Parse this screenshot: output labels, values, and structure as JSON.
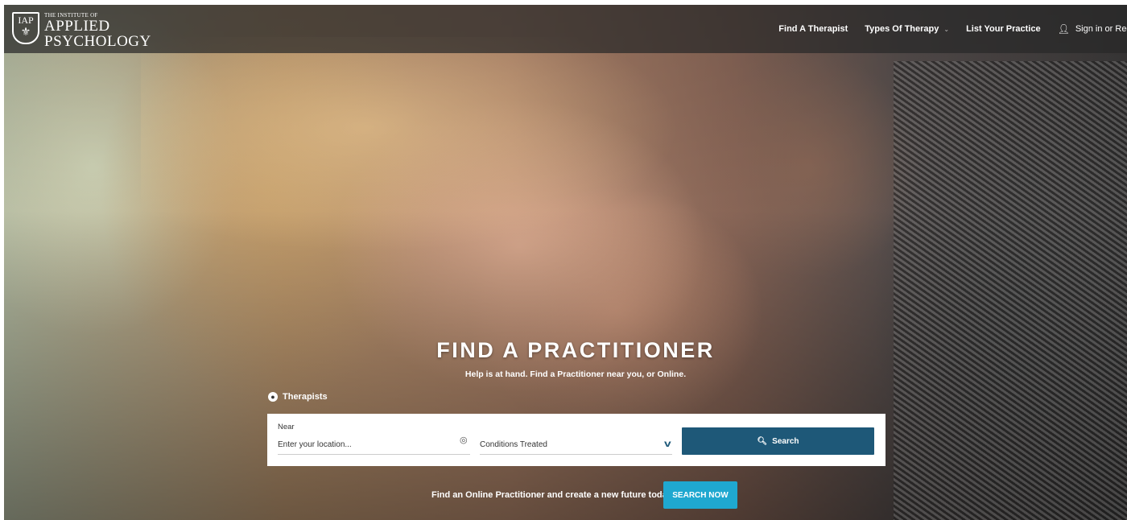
{
  "logo": {
    "abbr": "IAP",
    "line1": "THE INSTITUTE OF",
    "line2": "APPLIED",
    "line3": "PSYCHOLOGY"
  },
  "nav": {
    "find_therapist": "Find A Therapist",
    "types_of_therapy": "Types Of Therapy",
    "list_practice": "List Your Practice",
    "sign_in": "Sign in or Regi"
  },
  "hero": {
    "title": "FIND A PRACTITIONER",
    "subtitle": "Help is at hand. Find a Practitioner near you, or Online.",
    "tab_label": "Therapists"
  },
  "search": {
    "near_label": "Near",
    "location_placeholder": "Enter your location...",
    "conditions_label": "Conditions Treated",
    "button_label": "Search"
  },
  "cta": {
    "text": "Find an Online Practitioner and create a new future today",
    "button_label": "SEARCH NOW"
  },
  "colors": {
    "search_button": "#1e5878",
    "cta_button": "#1fa8d0",
    "navbar": "#282828"
  }
}
